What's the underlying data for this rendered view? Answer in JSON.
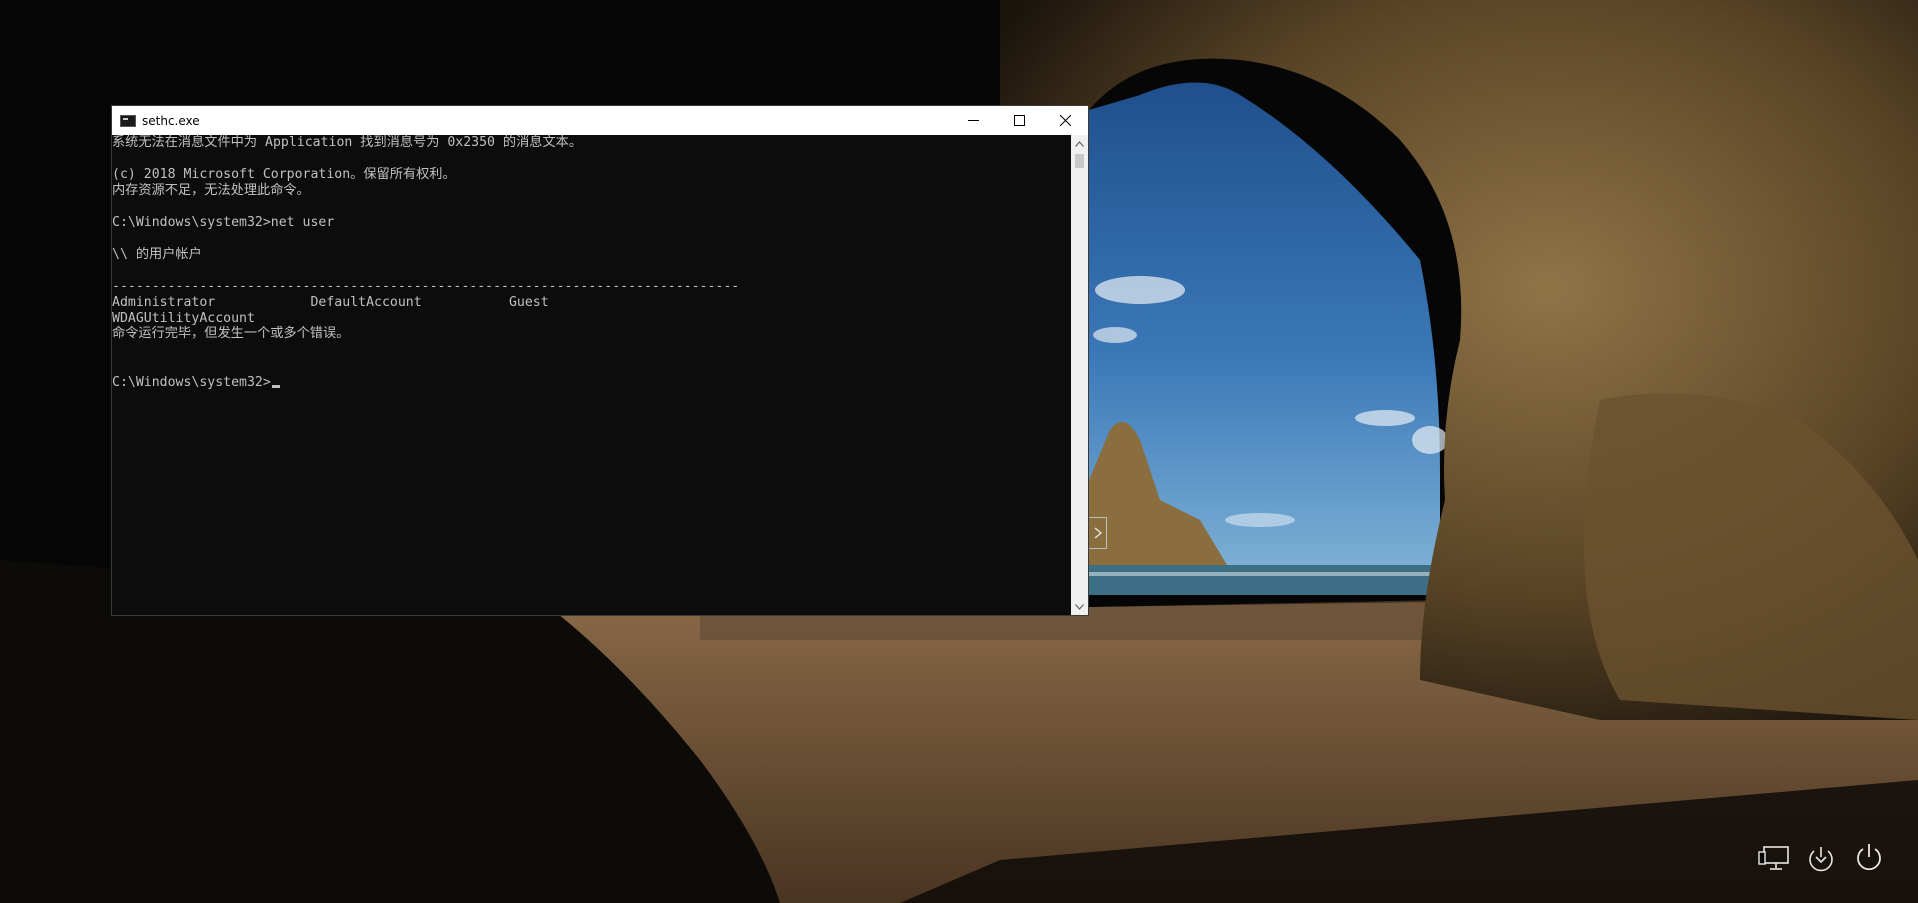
{
  "window": {
    "title": "sethc.exe",
    "minimize_icon": "minimize-icon",
    "maximize_icon": "maximize-icon",
    "close_icon": "close-icon"
  },
  "console": {
    "lines": [
      "系统无法在消息文件中为 Application 找到消息号为 0x2350 的消息文本。",
      "(c) 2018 Microsoft Corporation。保留所有权利。",
      "内存资源不足，无法处理此命令。",
      "C:\\Windows\\system32>net user",
      "\\\\ 的用户帐户",
      "-------------------------------------------------------------------------------",
      "Administrator            DefaultAccount           Guest",
      "WDAGUtilityAccount",
      "命令运行完毕，但发生一个或多个错误。",
      "C:\\Windows\\system32>"
    ]
  },
  "system_icons": {
    "network": "network-icon",
    "ease_of_access": "ease-of-access-icon",
    "power": "power-icon"
  },
  "colors": {
    "console_bg": "#0c0c0c",
    "console_text": "#c0c0c0",
    "titlebar_bg": "#ffffff"
  }
}
